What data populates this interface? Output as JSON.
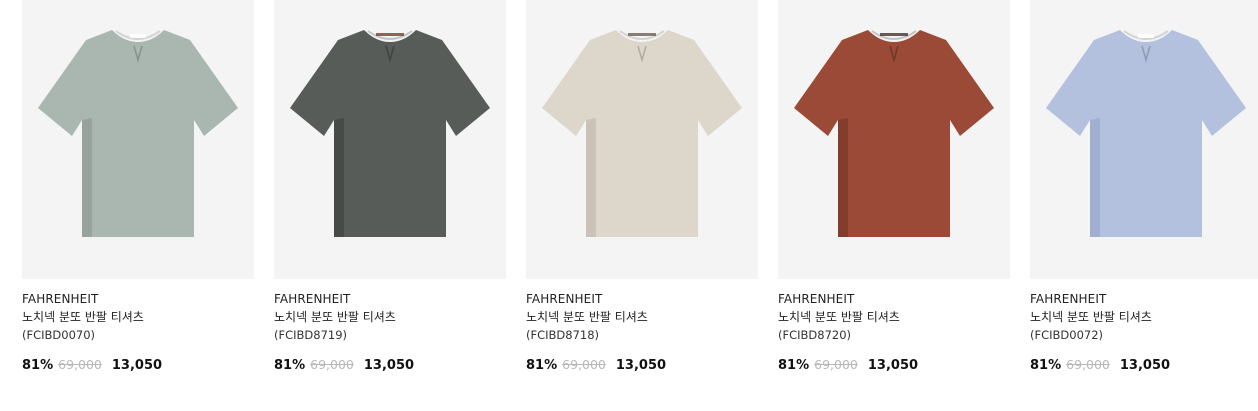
{
  "products": [
    {
      "brand": "FAHRENHEIT",
      "name": "노치넥 분또 반팔 티셔츠",
      "code": "(FCIBD0070)",
      "discount": "81%",
      "original_price": "69,000",
      "price": "13,050",
      "shirt_color": "#a9b7b0",
      "shade_color": "#96a49d"
    },
    {
      "brand": "FAHRENHEIT",
      "name": "노치넥 분또 반팔 티셔츠",
      "code": "(FCIBD8719)",
      "discount": "81%",
      "original_price": "69,000",
      "price": "13,050",
      "shirt_color": "#575c59",
      "shade_color": "#464b48"
    },
    {
      "brand": "FAHRENHEIT",
      "name": "노치넥 분또 반팔 티셔츠",
      "code": "(FCIBD8718)",
      "discount": "81%",
      "original_price": "69,000",
      "price": "13,050",
      "shirt_color": "#ddd6ca",
      "shade_color": "#cbc3b6"
    },
    {
      "brand": "FAHRENHEIT",
      "name": "노치넥 분또 반팔 티셔츠",
      "code": "(FCIBD8720)",
      "discount": "81%",
      "original_price": "69,000",
      "price": "13,050",
      "shirt_color": "#9a4a36",
      "shade_color": "#843d2c"
    },
    {
      "brand": "FAHRENHEIT",
      "name": "노치넥 분또 반팔 티셔츠",
      "code": "(FCIBD0072)",
      "discount": "81%",
      "original_price": "69,000",
      "price": "13,050",
      "shirt_color": "#b3c1de",
      "shade_color": "#a0afcf"
    }
  ]
}
